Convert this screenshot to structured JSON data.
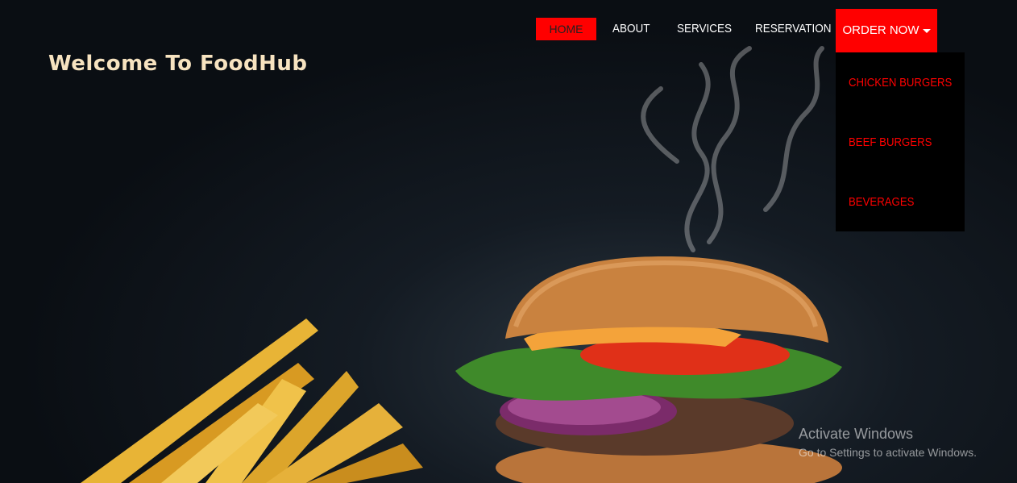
{
  "brand": {
    "title": "Welcome To FoodHub"
  },
  "nav": {
    "items": [
      {
        "label": "HOME",
        "active": true
      },
      {
        "label": "ABOUT"
      },
      {
        "label": "SERVICES"
      },
      {
        "label": "RESERVATION"
      }
    ],
    "order": {
      "label": "ORDER NOW",
      "icon": "caret-down-icon"
    }
  },
  "dropdown": {
    "items": [
      {
        "label": "CHICKEN BURGERS"
      },
      {
        "label": "BEEF BURGERS"
      },
      {
        "label": "BEVERAGES"
      }
    ]
  },
  "watermark": {
    "title": "Activate Windows",
    "subtitle": "Go to Settings to activate Windows."
  },
  "colors": {
    "accent": "#ff0000",
    "brand_text": "#f7e3c0",
    "background": "#0d1218"
  }
}
